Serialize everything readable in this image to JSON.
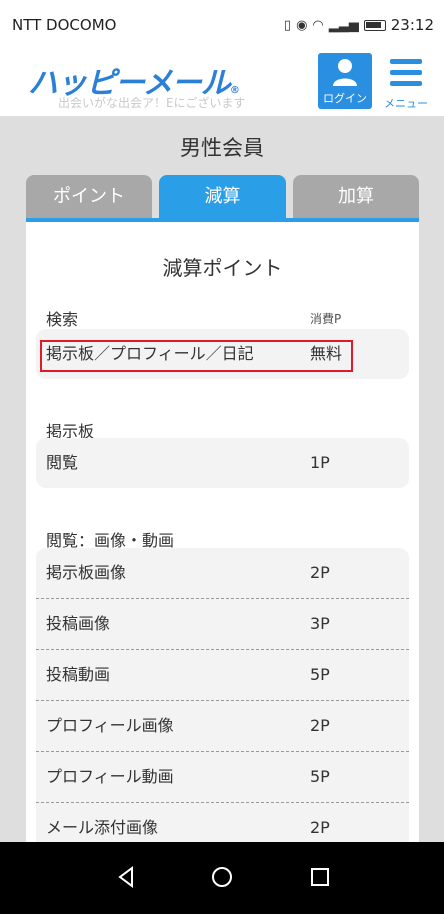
{
  "status": {
    "carrier": "NTT DOCOMO",
    "time": "23:12"
  },
  "header": {
    "logo_text": "ハッピーメール",
    "logo_mark": "®",
    "subtitle": "出会いがな出会ア！Eにございます",
    "login_label": "ログイン",
    "menu_label": "メニュー"
  },
  "page": {
    "section_title": "男性会員",
    "tabs": [
      {
        "label": "ポイント",
        "active": false
      },
      {
        "label": "減算",
        "active": true
      },
      {
        "label": "加算",
        "active": false
      }
    ],
    "panel_title": "減算ポイント"
  },
  "groups": [
    {
      "label": "検索",
      "unit": "消費P",
      "rows": [
        {
          "name": "掲示板／プロフィール／日記",
          "points": "無料"
        }
      ]
    },
    {
      "label": "掲示板",
      "rows": [
        {
          "name": "閲覧",
          "points": "1P"
        }
      ]
    },
    {
      "label": "閲覧：画像・動画",
      "rows": [
        {
          "name": "掲示板画像",
          "points": "2P"
        },
        {
          "name": "投稿画像",
          "points": "3P"
        },
        {
          "name": "投稿動画",
          "points": "5P"
        },
        {
          "name": "プロフィール画像",
          "points": "2P"
        },
        {
          "name": "プロフィール動画",
          "points": "5P"
        },
        {
          "name": "メール添付画像",
          "points": "2P"
        }
      ]
    }
  ],
  "colors": {
    "accent": "#2a9ee6",
    "tab_inactive": "#a8a8a8",
    "highlight": "#e0192b"
  }
}
